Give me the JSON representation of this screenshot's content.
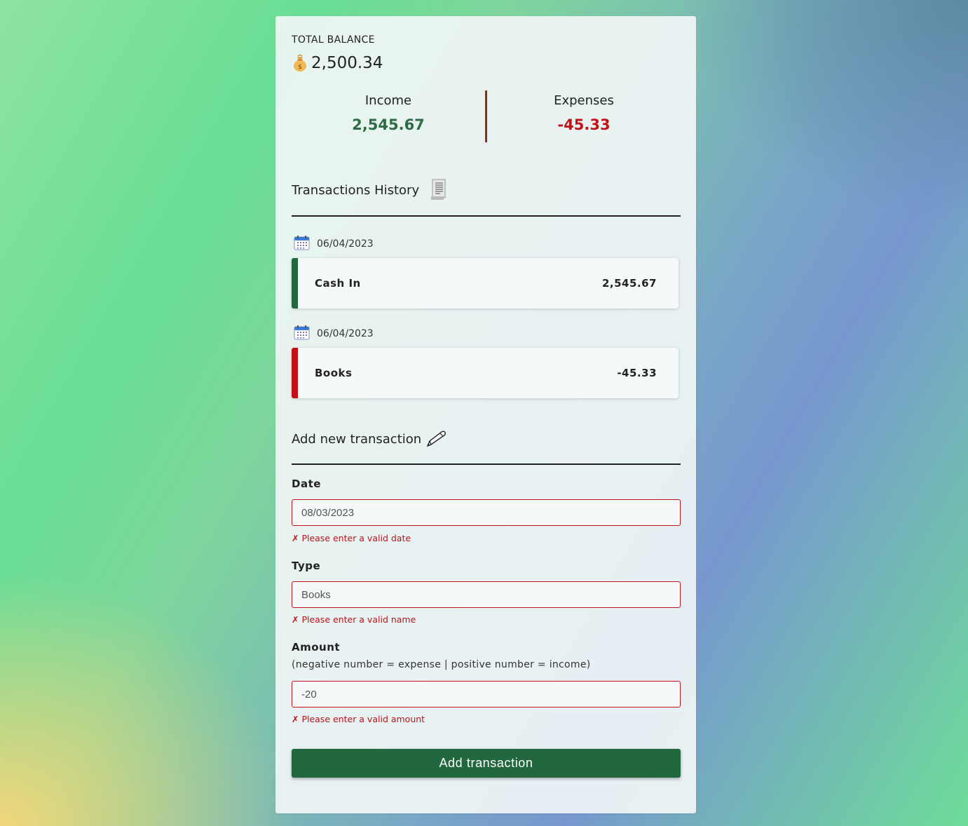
{
  "balance": {
    "label": "TOTAL BALANCE",
    "icon": "money-bag-icon",
    "value": "2,500.34"
  },
  "summary": {
    "income_label": "Income",
    "income_value": "2,545.67",
    "expenses_label": "Expenses",
    "expenses_value": "-45.33"
  },
  "history": {
    "title": "Transactions History",
    "icon": "receipt-icon",
    "items": [
      {
        "date": "06/04/2023",
        "name": "Cash In",
        "amount": "2,545.67",
        "kind": "income"
      },
      {
        "date": "06/04/2023",
        "name": "Books",
        "amount": "-45.33",
        "kind": "expense"
      }
    ]
  },
  "form": {
    "title": "Add new transaction",
    "icon": "pen-icon",
    "date_label": "Date",
    "date_value": "08/03/2023",
    "date_error": "✗ Please enter a valid date",
    "type_label": "Type",
    "type_value": "Books",
    "type_error": "✗ Please enter a valid name",
    "amount_label": "Amount",
    "amount_hint": "(negative number = expense | positive number = income)",
    "amount_value": "-20",
    "amount_error": "✗ Please enter a valid amount",
    "submit_label": "Add transaction"
  },
  "colors": {
    "income": "#22683f",
    "expense": "#c00f16",
    "error": "#c0141a"
  }
}
